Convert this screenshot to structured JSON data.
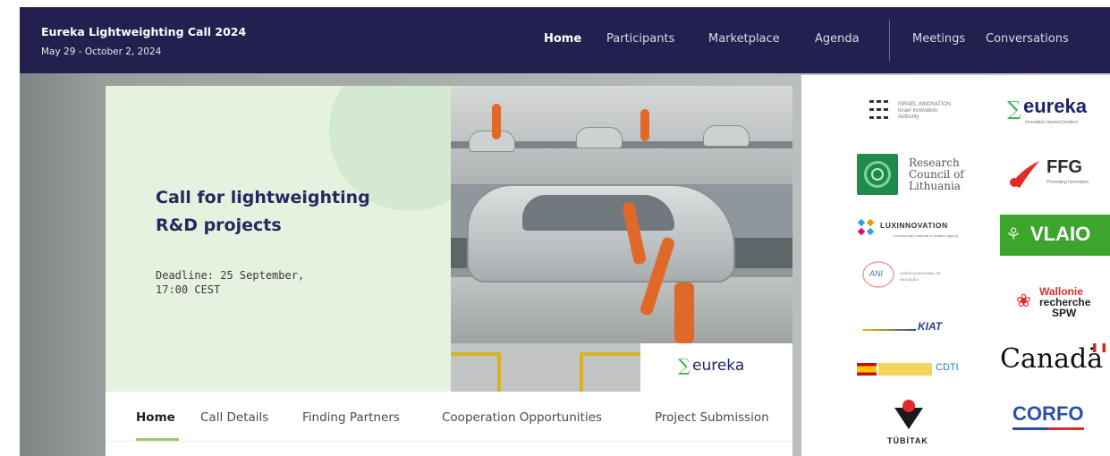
{
  "header": {
    "event_title": "Eureka Lightweighting Call 2024",
    "event_dates": "May 29 - October 2, 2024",
    "nav": [
      {
        "label": "Home",
        "active": true
      },
      {
        "label": "Participants",
        "active": false
      },
      {
        "label": "Marketplace",
        "active": false
      },
      {
        "label": "Agenda",
        "active": false
      },
      {
        "label": "Meetings",
        "active": false
      },
      {
        "label": "Conversations",
        "active": false
      }
    ]
  },
  "hero": {
    "title_line1": "Call for lightweighting",
    "title_line2": "R&D projects",
    "deadline_line1": "Deadline: 25 September,",
    "deadline_line2": "17:00 CEST",
    "eureka_logo_text": "eureka",
    "eureka_logo_sigma": "∑",
    "hero_image": "factory-car-assembly-robots"
  },
  "card_nav": [
    {
      "label": "Home",
      "active": true
    },
    {
      "label": "Call Details",
      "active": false
    },
    {
      "label": "Finding Partners",
      "active": false
    },
    {
      "label": "Cooperation Opportunities",
      "active": false
    },
    {
      "label": "Project Submission",
      "active": false
    }
  ],
  "partner_logos": {
    "israel_innovation": {
      "lines": [
        "ISRAEL INNOVATION",
        "Israel Innovation",
        "Authority"
      ]
    },
    "eureka": {
      "text": "eureka",
      "sub": "Innovation beyond borders"
    },
    "research_council_lithuania": {
      "lines": [
        "Research",
        "Council of",
        "Lithuania"
      ]
    },
    "ffg": {
      "text": "FFG",
      "sub": "Promoting Innovation"
    },
    "luxinnovation": {
      "text": "LUXINNOVATION",
      "sub": "Luxembourg's national innovation agency"
    },
    "vlaio": {
      "text": "VLAIO"
    },
    "ani": {
      "text": "ANI",
      "sub": "AGÊNCIA NACIONAL DE INOVAÇÃO"
    },
    "wallonie": {
      "lines": [
        "Wallonie",
        "recherche",
        "SPW"
      ]
    },
    "kiat": {
      "text": "KIAT"
    },
    "canada": {
      "text": "Canadä"
    },
    "cdti": {
      "text": "CDTI"
    },
    "corfo": {
      "text": "CORFO"
    },
    "tubitak": {
      "text": "TÜBİTAK"
    }
  },
  "colors": {
    "header_bg": "#23204f",
    "hero_bg": "#e5f2df",
    "title_color": "#27285e",
    "accent_green": "#9cc46c",
    "eureka_green": "#35b14a",
    "eureka_blue": "#1d2466"
  }
}
